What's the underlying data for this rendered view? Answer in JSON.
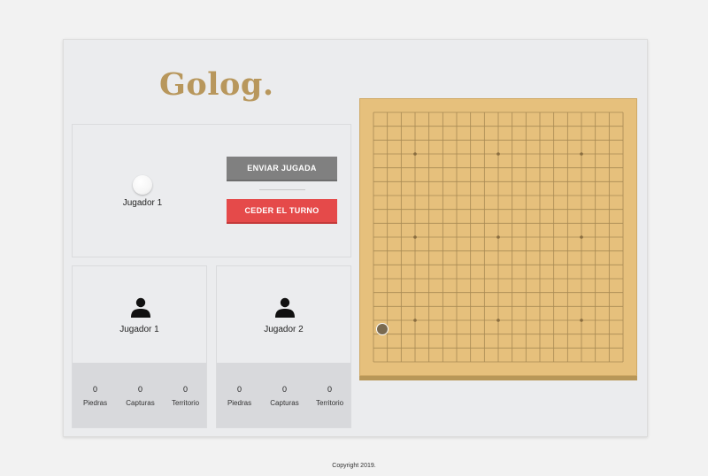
{
  "app": {
    "logo": "Golog."
  },
  "turn": {
    "current_player": "Jugador 1",
    "current_color": "white",
    "send_button": "ENVIAR JUGADA",
    "pass_button": "CEDER EL TURNO"
  },
  "players": [
    {
      "name": "Jugador 1",
      "stats": [
        {
          "value": "0",
          "label": "Piedras"
        },
        {
          "value": "0",
          "label": "Capturas"
        },
        {
          "value": "0",
          "label": "Territorio"
        }
      ]
    },
    {
      "name": "Jugador 2",
      "stats": [
        {
          "value": "0",
          "label": "Piedras"
        },
        {
          "value": "0",
          "label": "Capturas"
        },
        {
          "value": "0",
          "label": "Territorio"
        }
      ]
    }
  ],
  "board": {
    "size": 19,
    "star_points": [
      [
        3,
        3
      ],
      [
        3,
        9
      ],
      [
        3,
        15
      ],
      [
        9,
        3
      ],
      [
        9,
        9
      ],
      [
        9,
        15
      ],
      [
        15,
        3
      ],
      [
        15,
        9
      ],
      [
        15,
        15
      ]
    ],
    "hover_stone": {
      "col": 0,
      "row": 15,
      "color": "#7a6a50"
    },
    "colors": {
      "wood": "#e6c07c",
      "line": "#a88a54",
      "star": "#8a6e40"
    }
  },
  "footer": {
    "text": "Copyright 2019."
  }
}
